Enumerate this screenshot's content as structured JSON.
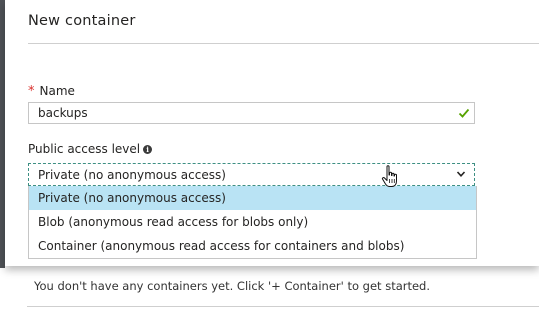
{
  "blade": {
    "title": "New container"
  },
  "name_field": {
    "required_marker": "*",
    "label": "Name",
    "value": "backups",
    "valid_icon": "checkmark-icon",
    "valid_color": "#57a300"
  },
  "access_field": {
    "label": "Public access level",
    "info_icon": "info-icon",
    "selected_value": "Private (no anonymous access)",
    "chevron_icon": "chevron-down-icon",
    "options": [
      {
        "label": "Private (no anonymous access)",
        "highlighted": true
      },
      {
        "label": "Blob (anonymous read access for blobs only)",
        "highlighted": false
      },
      {
        "label": "Container (anonymous read access for containers and blobs)",
        "highlighted": false
      }
    ]
  },
  "background": {
    "empty_message": "You don't have any containers yet. Click '+ Container' to get started."
  },
  "colors": {
    "highlight": "#b9e3f4",
    "required": "#d9302c",
    "focus_border": "#3d8f83"
  }
}
